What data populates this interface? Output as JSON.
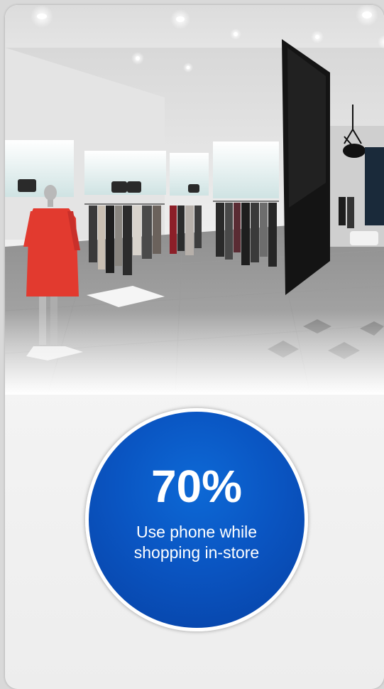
{
  "stat": {
    "value": "70%",
    "caption": "Use phone while shopping in-store"
  },
  "colors": {
    "circle": "#0a55c2",
    "background": "#d9d9d9",
    "dress": "#e23a2f"
  },
  "photo": {
    "icon": "retail-store-interior-photo"
  }
}
